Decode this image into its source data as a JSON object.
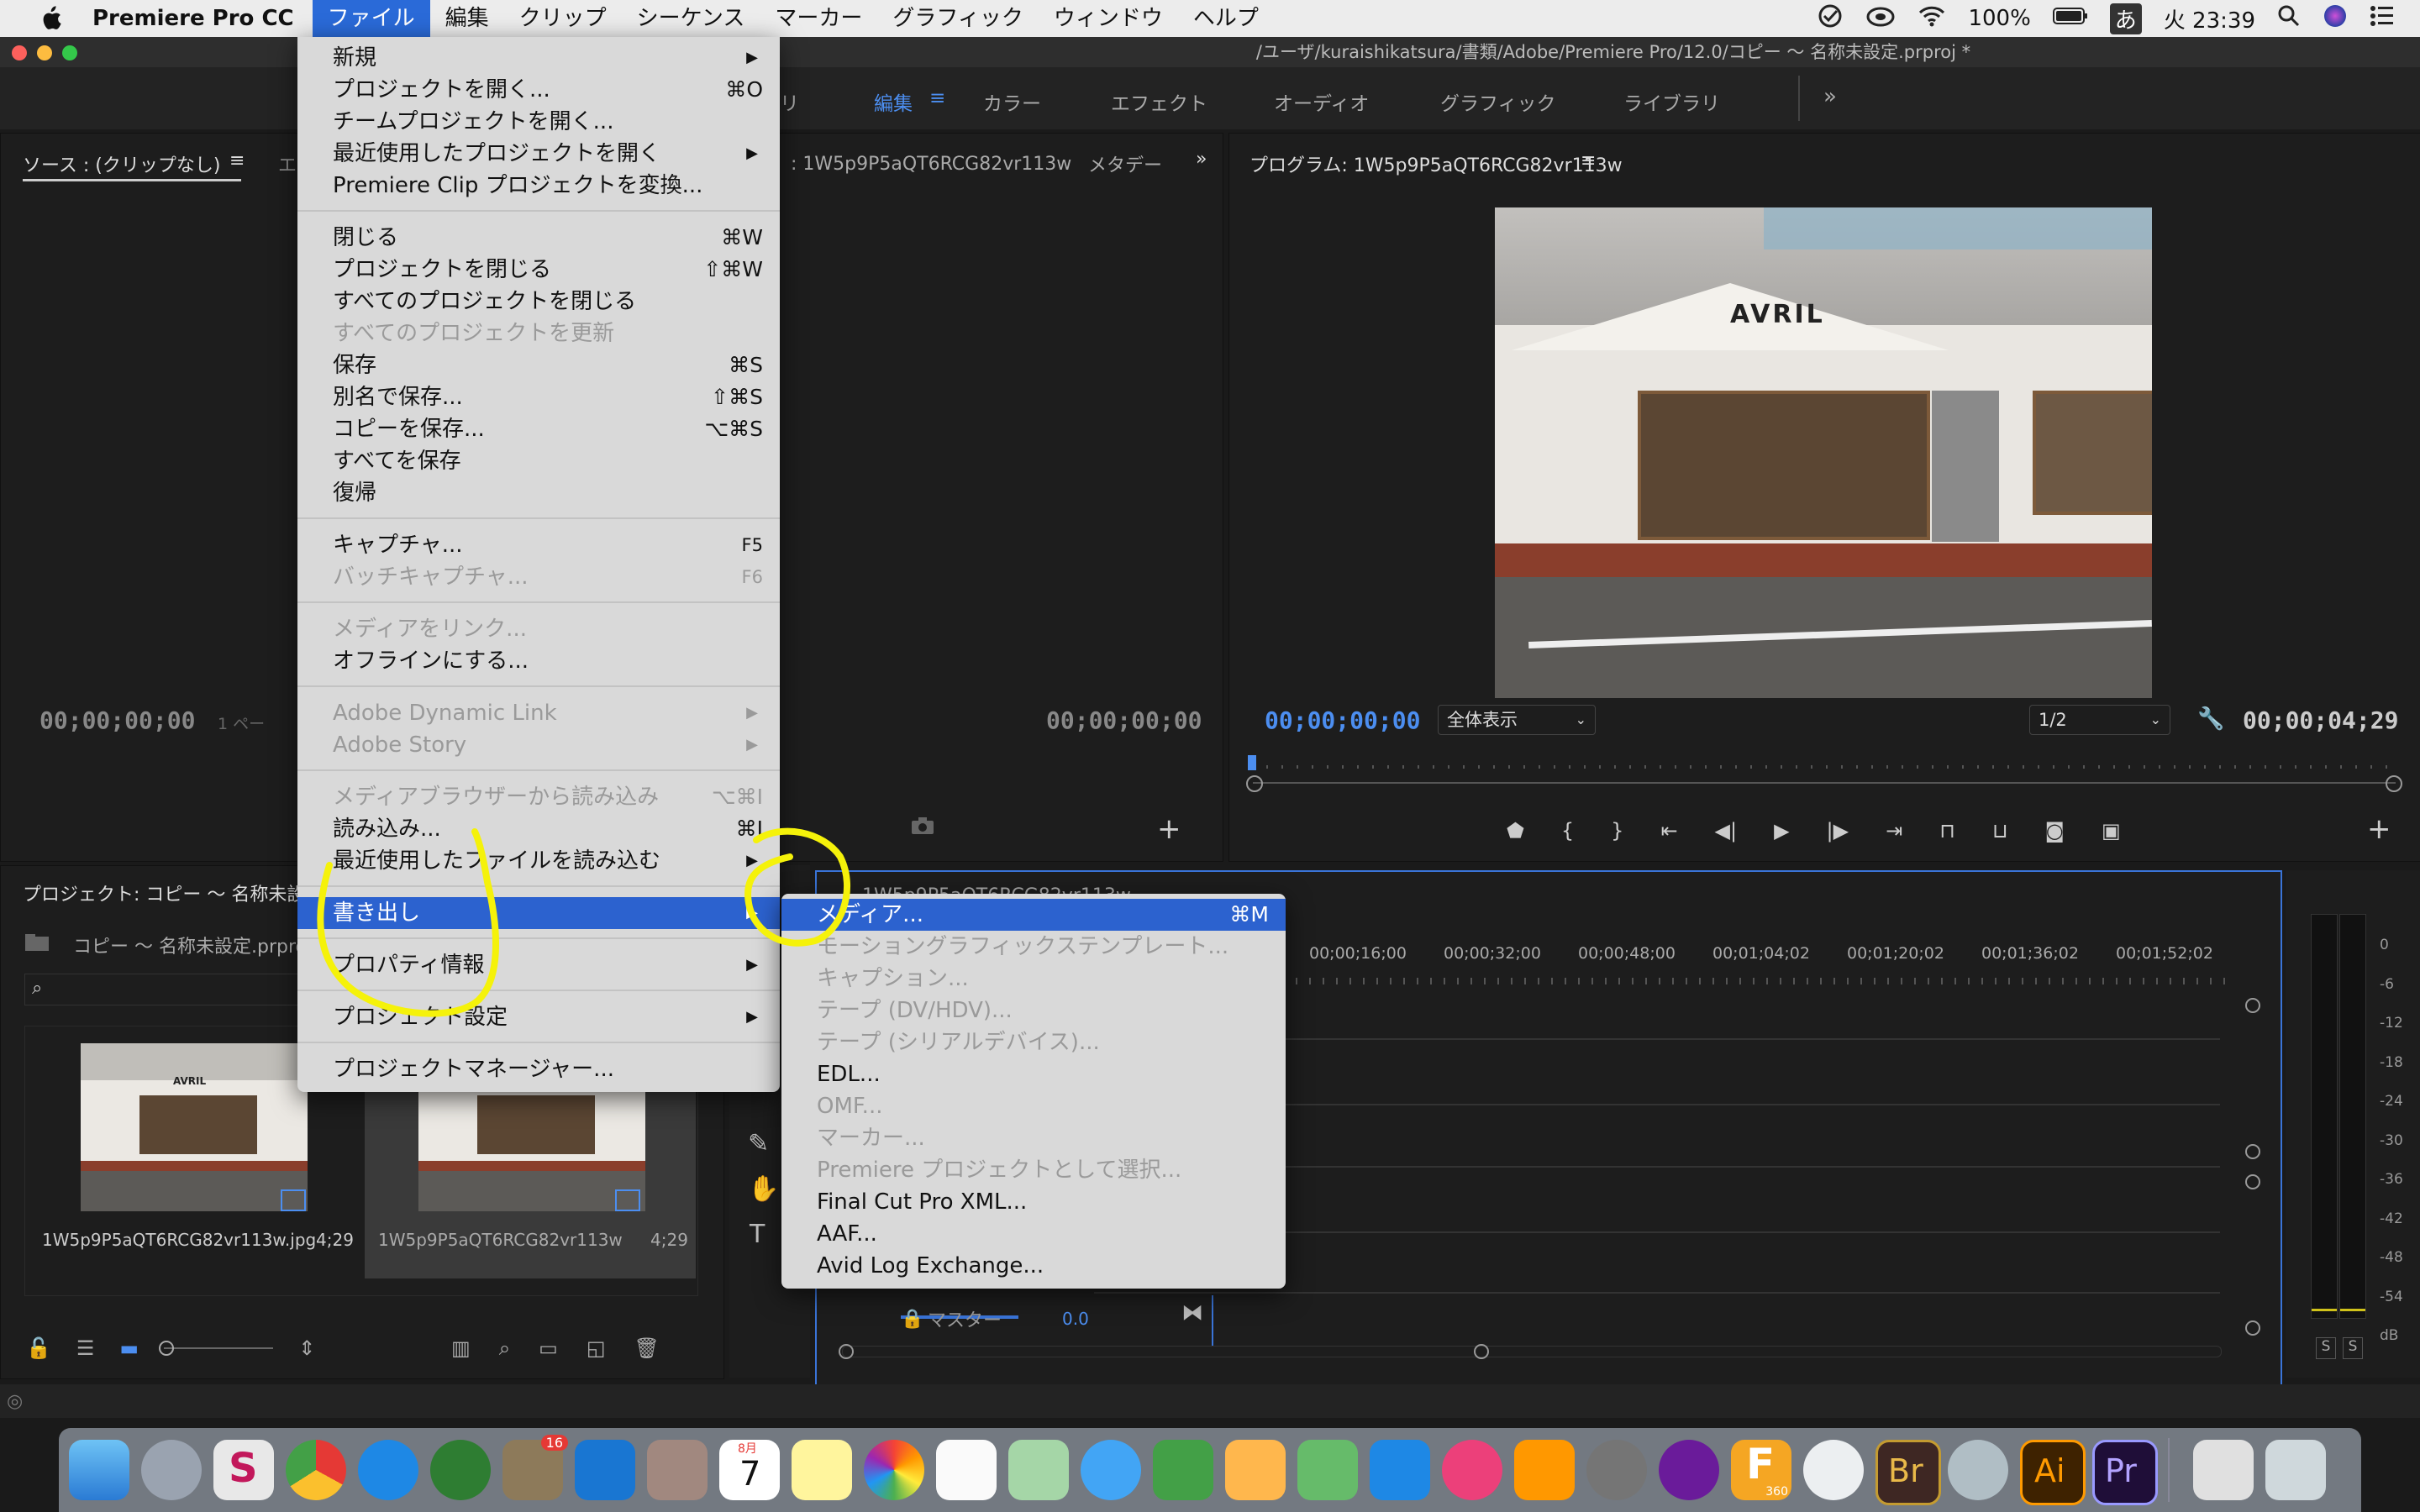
{
  "menubar": {
    "app_name": "Premiere Pro CC",
    "menus": [
      "ファイル",
      "編集",
      "クリップ",
      "シーケンス",
      "マーカー",
      "グラフィック",
      "ウィンドウ",
      "ヘルプ"
    ],
    "battery": "100%",
    "input_method": "あ",
    "clock": "火 23:39"
  },
  "window": {
    "title": "/ユーザ/kuraishikatsura/書類/Adobe/Premiere Pro/12.0/コピー ～ 名称未設定.prproj *"
  },
  "workspaces": [
    "リ",
    "編集",
    "カラー",
    "エフェクト",
    "オーディオ",
    "グラフィック",
    "ライブラリ"
  ],
  "source_panel": {
    "tab": "ソース : (クリップなし)",
    "tab2": "エ",
    "timecode_left": "00;00;00;00",
    "page": "1 ペー",
    "timecode_right": "00;00;00;00",
    "mid_tab": ": 1W5p9P5aQT6RCG82vr113w",
    "meta_tab": "メタデー"
  },
  "program_panel": {
    "title": "プログラム: 1W5p9P5aQT6RCG82vr113w",
    "timecode": "00;00;00;00",
    "fit": "全体表示",
    "resolution": "1/2",
    "duration": "00;00;04;29",
    "sign_text": "AVRIL"
  },
  "project_panel": {
    "title": "プロジェクト: コピー ～ 名称未設",
    "file": "コピー ～ 名称未設定.prproj",
    "items": [
      {
        "name": "1W5p9P5aQT6RCG82vr113w.jpg",
        "duration": "4;29",
        "thumb_text": "AVRIL"
      },
      {
        "name": "1W5p9P5aQT6RCG82vr113w",
        "duration": "4;29"
      }
    ]
  },
  "timeline": {
    "tab": "1W5p9P5aQT6RCG82vr113w",
    "ruler": [
      "00;00;16;00",
      "00;00;32;00",
      "00;00;48;00",
      "00;01;04;02",
      "00;01;20;02",
      "00;01;36;02",
      "00;01;52;02"
    ],
    "master_label": "マスター",
    "master_value": "0.0"
  },
  "meter": {
    "scale": [
      "0",
      "-6",
      "-12",
      "-18",
      "-24",
      "-30",
      "-36",
      "-42",
      "-48",
      "-54",
      "dB"
    ],
    "solo": [
      "S",
      "S"
    ]
  },
  "file_menu": {
    "items": [
      {
        "label": "新規",
        "shortcut": "",
        "submenu": true,
        "disabled": false
      },
      {
        "label": "プロジェクトを開く...",
        "shortcut": "⌘O",
        "submenu": false,
        "disabled": false
      },
      {
        "label": "チームプロジェクトを開く...",
        "shortcut": "",
        "submenu": false,
        "disabled": false
      },
      {
        "label": "最近使用したプロジェクトを開く",
        "shortcut": "",
        "submenu": true,
        "disabled": false
      },
      {
        "label": "Premiere Clip プロジェクトを変換...",
        "shortcut": "",
        "submenu": false,
        "disabled": false
      },
      {
        "label": "閉じる",
        "shortcut": "⌘W",
        "submenu": false,
        "disabled": false
      },
      {
        "label": "プロジェクトを閉じる",
        "shortcut": "⇧⌘W",
        "submenu": false,
        "disabled": false
      },
      {
        "label": "すべてのプロジェクトを閉じる",
        "shortcut": "",
        "submenu": false,
        "disabled": false
      },
      {
        "label": "すべてのプロジェクトを更新",
        "shortcut": "",
        "submenu": false,
        "disabled": true
      },
      {
        "label": "保存",
        "shortcut": "⌘S",
        "submenu": false,
        "disabled": false
      },
      {
        "label": "別名で保存...",
        "shortcut": "⇧⌘S",
        "submenu": false,
        "disabled": false
      },
      {
        "label": "コピーを保存...",
        "shortcut": "⌥⌘S",
        "submenu": false,
        "disabled": false
      },
      {
        "label": "すべてを保存",
        "shortcut": "",
        "submenu": false,
        "disabled": false
      },
      {
        "label": "復帰",
        "shortcut": "",
        "submenu": false,
        "disabled": false
      },
      {
        "label": "キャプチャ...",
        "shortcut": "F5",
        "submenu": false,
        "disabled": false
      },
      {
        "label": "バッチキャプチャ...",
        "shortcut": "F6",
        "submenu": false,
        "disabled": true
      },
      {
        "label": "メディアをリンク...",
        "shortcut": "",
        "submenu": false,
        "disabled": true
      },
      {
        "label": "オフラインにする...",
        "shortcut": "",
        "submenu": false,
        "disabled": false
      },
      {
        "label": "Adobe Dynamic Link",
        "shortcut": "",
        "submenu": true,
        "disabled": true
      },
      {
        "label": "Adobe Story",
        "shortcut": "",
        "submenu": true,
        "disabled": true
      },
      {
        "label": "メディアブラウザーから読み込み",
        "shortcut": "⌥⌘I",
        "submenu": false,
        "disabled": true
      },
      {
        "label": "読み込み...",
        "shortcut": "⌘I",
        "submenu": false,
        "disabled": false
      },
      {
        "label": "最近使用したファイルを読み込む",
        "shortcut": "",
        "submenu": true,
        "disabled": false
      },
      {
        "label": "書き出し",
        "shortcut": "",
        "submenu": true,
        "disabled": false
      },
      {
        "label": "プロパティ情報",
        "shortcut": "",
        "submenu": true,
        "disabled": false
      },
      {
        "label": "プロジェクト設定",
        "shortcut": "",
        "submenu": true,
        "disabled": false
      },
      {
        "label": "プロジェクトマネージャー...",
        "shortcut": "",
        "submenu": false,
        "disabled": false
      }
    ]
  },
  "export_submenu": {
    "items": [
      {
        "label": "メディア...",
        "shortcut": "⌘M",
        "disabled": false
      },
      {
        "label": "モーショングラフィックステンプレート...",
        "shortcut": "",
        "disabled": true
      },
      {
        "label": "キャプション...",
        "shortcut": "",
        "disabled": true
      },
      {
        "label": "テープ (DV/HDV)...",
        "shortcut": "",
        "disabled": true
      },
      {
        "label": "テープ (シリアルデバイス)...",
        "shortcut": "",
        "disabled": true
      },
      {
        "label": "EDL...",
        "shortcut": "",
        "disabled": false
      },
      {
        "label": "OMF...",
        "shortcut": "",
        "disabled": true
      },
      {
        "label": "マーカー...",
        "shortcut": "",
        "disabled": true
      },
      {
        "label": "Premiere プロジェクトとして選択...",
        "shortcut": "",
        "disabled": true
      },
      {
        "label": "Final Cut Pro XML...",
        "shortcut": "",
        "disabled": false
      },
      {
        "label": "AAF...",
        "shortcut": "",
        "disabled": false
      },
      {
        "label": "Avid Log Exchange...",
        "shortcut": "",
        "disabled": false
      }
    ]
  },
  "dock": {
    "badges": {
      "mail": "16",
      "calendar_month": "8月",
      "calendar_day": "7",
      "fusion": "360",
      "bridge": "Br",
      "illustrator": "Ai",
      "premiere": "Pr"
    }
  },
  "colors": {
    "accent": "#2c62cf",
    "timecode_blue": "#4c8ef0",
    "highlight_yellow": "#f5f20a"
  }
}
